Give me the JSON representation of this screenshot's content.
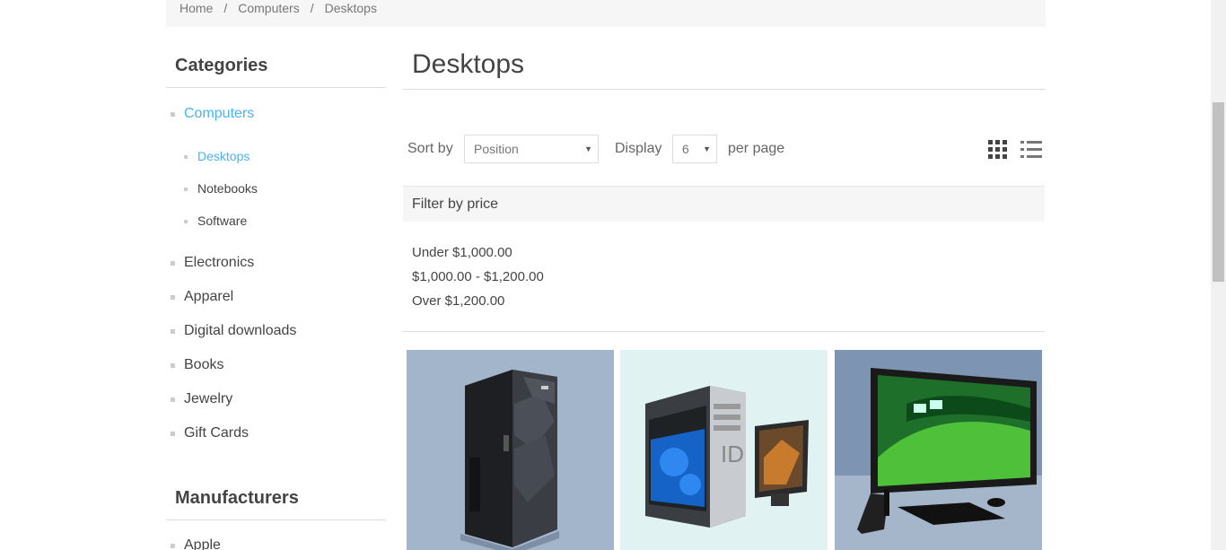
{
  "breadcrumb": {
    "home": "Home",
    "computers": "Computers",
    "current": "Desktops",
    "separator": "/"
  },
  "sidebar": {
    "categories_title": "Categories",
    "categories": [
      {
        "label": "Computers",
        "active": true
      },
      {
        "label": "Electronics"
      },
      {
        "label": "Apparel"
      },
      {
        "label": "Digital downloads"
      },
      {
        "label": "Books"
      },
      {
        "label": "Jewelry"
      },
      {
        "label": "Gift Cards"
      }
    ],
    "subcategories": [
      {
        "label": "Desktops",
        "active": true
      },
      {
        "label": "Notebooks"
      },
      {
        "label": "Software"
      }
    ],
    "manufacturers_title": "Manufacturers",
    "manufacturers": [
      {
        "label": "Apple"
      }
    ]
  },
  "main": {
    "title": "Desktops",
    "sort_label": "Sort by",
    "sort_value": "Position",
    "display_label": "Display",
    "display_value": "6",
    "per_page_label": "per page",
    "grid_view_icon": "grid-view-icon",
    "list_view_icon": "list-view-icon"
  },
  "filter": {
    "title": "Filter by price",
    "ranges": [
      "Under $1,000.00",
      "$1,000.00 - $1,200.00",
      "Over $1,200.00"
    ]
  },
  "products": [
    {
      "image": "server-tower-image",
      "bg": "#a3b5cb"
    },
    {
      "image": "gaming-pc-image",
      "bg": "#e0f2f2"
    },
    {
      "image": "all-in-one-pc-image",
      "bg": "#7d95b2"
    }
  ],
  "colors": {
    "accent": "#4ab2f1",
    "text": "#444444",
    "panel": "#f6f6f6"
  }
}
